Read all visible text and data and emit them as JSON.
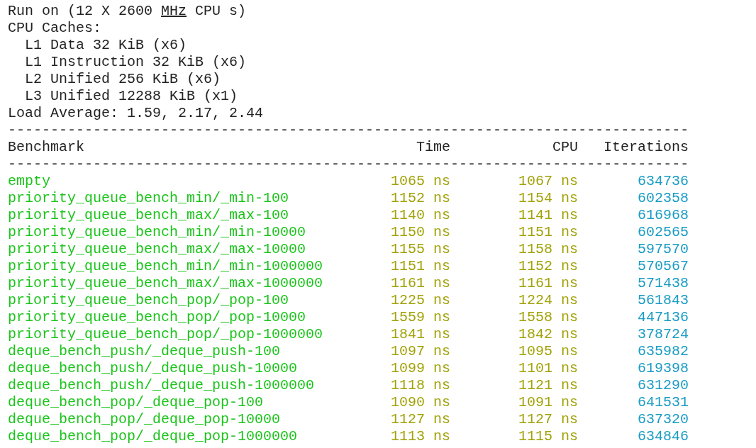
{
  "run_info": {
    "text_before": "Run on (12 X 2600 ",
    "underlined": "MHz",
    "text_after": " CPU s)"
  },
  "caches_title": "CPU Caches:",
  "caches": [
    "L1 Data 32 KiB (x6)",
    "L1 Instruction 32 KiB (x6)",
    "L2 Unified 256 KiB (x6)",
    "L3 Unified 12288 KiB (x1)"
  ],
  "load_average": "Load Average: 1.59, 2.17, 2.44",
  "separator": "--------------------------------------------------------------------------------",
  "columns": [
    "Benchmark",
    "Time",
    "CPU",
    "Iterations"
  ],
  "rows": [
    {
      "name": "empty",
      "time": "1065 ns",
      "cpu": "1067 ns",
      "iterations": "634736"
    },
    {
      "name": "priority_queue_bench_min/_min-100",
      "time": "1152 ns",
      "cpu": "1154 ns",
      "iterations": "602358"
    },
    {
      "name": "priority_queue_bench_max/_max-100",
      "time": "1140 ns",
      "cpu": "1141 ns",
      "iterations": "616968"
    },
    {
      "name": "priority_queue_bench_min/_min-10000",
      "time": "1150 ns",
      "cpu": "1151 ns",
      "iterations": "602565"
    },
    {
      "name": "priority_queue_bench_max/_max-10000",
      "time": "1155 ns",
      "cpu": "1158 ns",
      "iterations": "597570"
    },
    {
      "name": "priority_queue_bench_min/_min-1000000",
      "time": "1151 ns",
      "cpu": "1152 ns",
      "iterations": "570567"
    },
    {
      "name": "priority_queue_bench_max/_max-1000000",
      "time": "1161 ns",
      "cpu": "1161 ns",
      "iterations": "571438"
    },
    {
      "name": "priority_queue_bench_pop/_pop-100",
      "time": "1225 ns",
      "cpu": "1224 ns",
      "iterations": "561843"
    },
    {
      "name": "priority_queue_bench_pop/_pop-10000",
      "time": "1559 ns",
      "cpu": "1558 ns",
      "iterations": "447136"
    },
    {
      "name": "priority_queue_bench_pop/_pop-1000000",
      "time": "1841 ns",
      "cpu": "1842 ns",
      "iterations": "378724"
    },
    {
      "name": "deque_bench_push/_deque_push-100",
      "time": "1097 ns",
      "cpu": "1095 ns",
      "iterations": "635982"
    },
    {
      "name": "deque_bench_push/_deque_push-10000",
      "time": "1099 ns",
      "cpu": "1101 ns",
      "iterations": "619398"
    },
    {
      "name": "deque_bench_push/_deque_push-1000000",
      "time": "1118 ns",
      "cpu": "1121 ns",
      "iterations": "631290"
    },
    {
      "name": "deque_bench_pop/_deque_pop-100",
      "time": "1090 ns",
      "cpu": "1091 ns",
      "iterations": "641531"
    },
    {
      "name": "deque_bench_pop/_deque_pop-10000",
      "time": "1127 ns",
      "cpu": "1127 ns",
      "iterations": "637320"
    },
    {
      "name": "deque_bench_pop/_deque_pop-1000000",
      "time": "1113 ns",
      "cpu": "1115 ns",
      "iterations": "634846"
    }
  ]
}
